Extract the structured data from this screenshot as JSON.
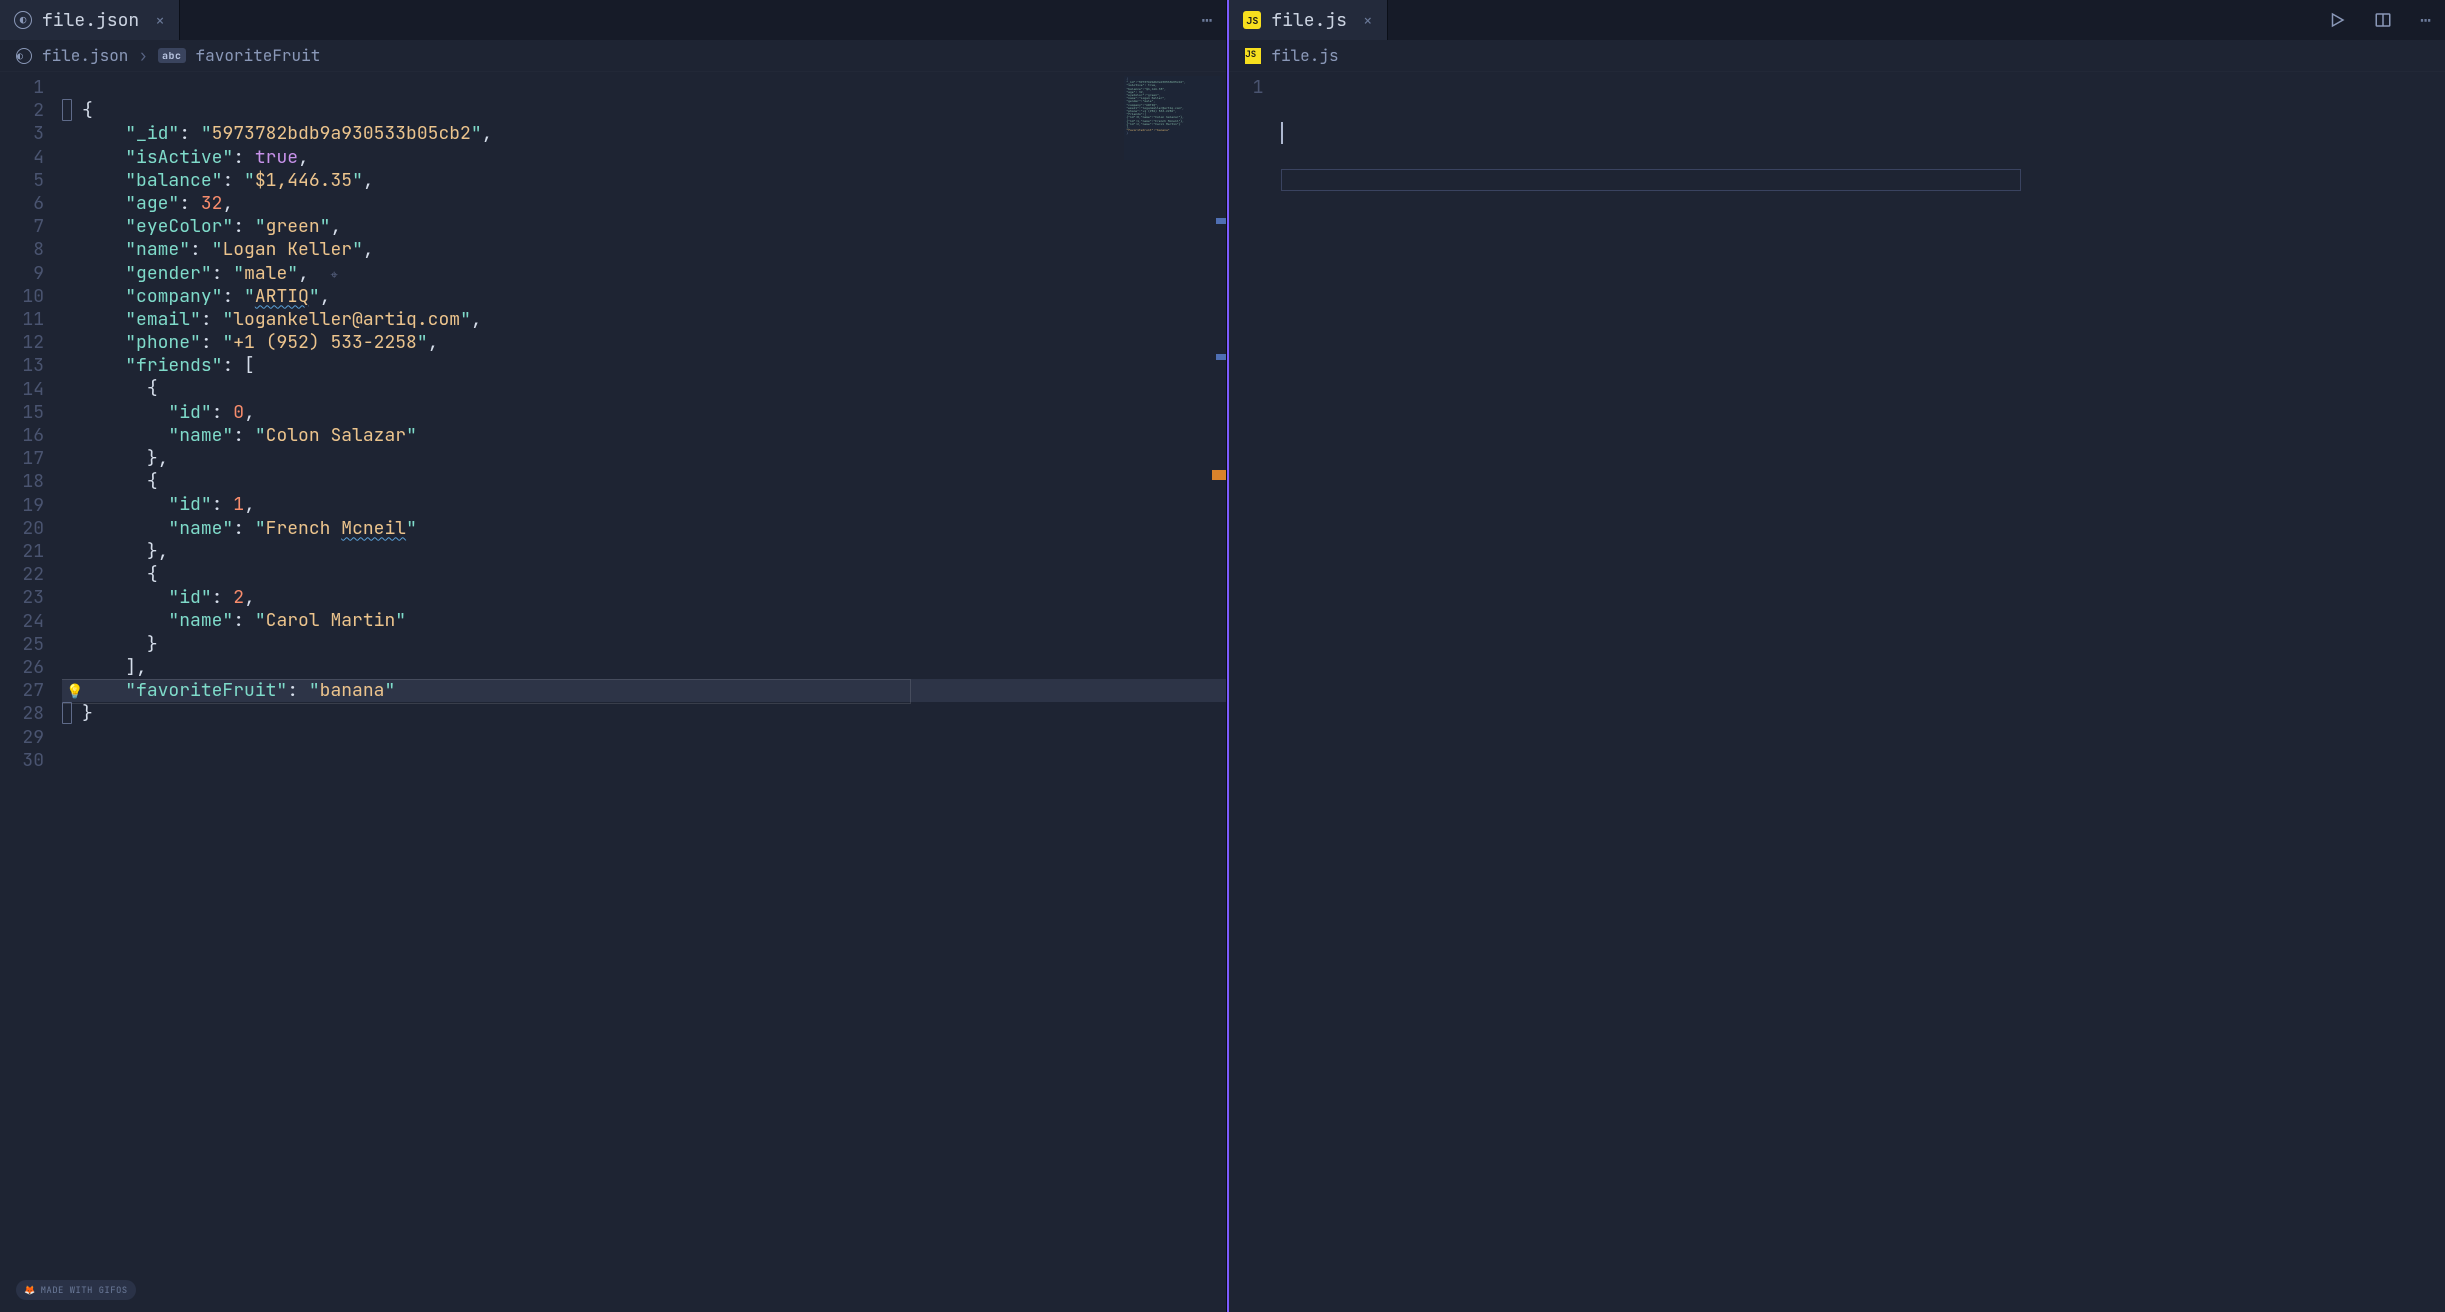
{
  "left": {
    "tab": {
      "filename": "file.json"
    },
    "breadcrumb": {
      "file": "file.json",
      "badge": "abc",
      "symbol": "favoriteFruit"
    },
    "lines": [
      1,
      2,
      3,
      4,
      5,
      6,
      7,
      8,
      9,
      10,
      11,
      12,
      13,
      14,
      15,
      16,
      17,
      18,
      19,
      20,
      21,
      22,
      23,
      24,
      25,
      26,
      27,
      28,
      29,
      30
    ],
    "json": {
      "_id": "5973782bdb9a930533b05cb2",
      "isActive": true,
      "balance": "$1,446.35",
      "age": 32,
      "eyeColor": "green",
      "name": "Logan Keller",
      "gender": "male",
      "company": "ARTIQ",
      "email": "logankeller@artiq.com",
      "phone": "+1 (952) 533-2258",
      "friends": [
        {
          "id": 0,
          "name": "Colon Salazar"
        },
        {
          "id": 1,
          "name": "French Mcneil"
        },
        {
          "id": 2,
          "name": "Carol Martin"
        }
      ],
      "favoriteFruit": "banana"
    },
    "highlighted_line": 27,
    "lightbulb_line": 27
  },
  "right": {
    "tab": {
      "filename": "file.js"
    },
    "breadcrumb": {
      "file": "file.js"
    },
    "lines": [
      1
    ]
  },
  "footer_badge": "MADE WITH GIFOS"
}
